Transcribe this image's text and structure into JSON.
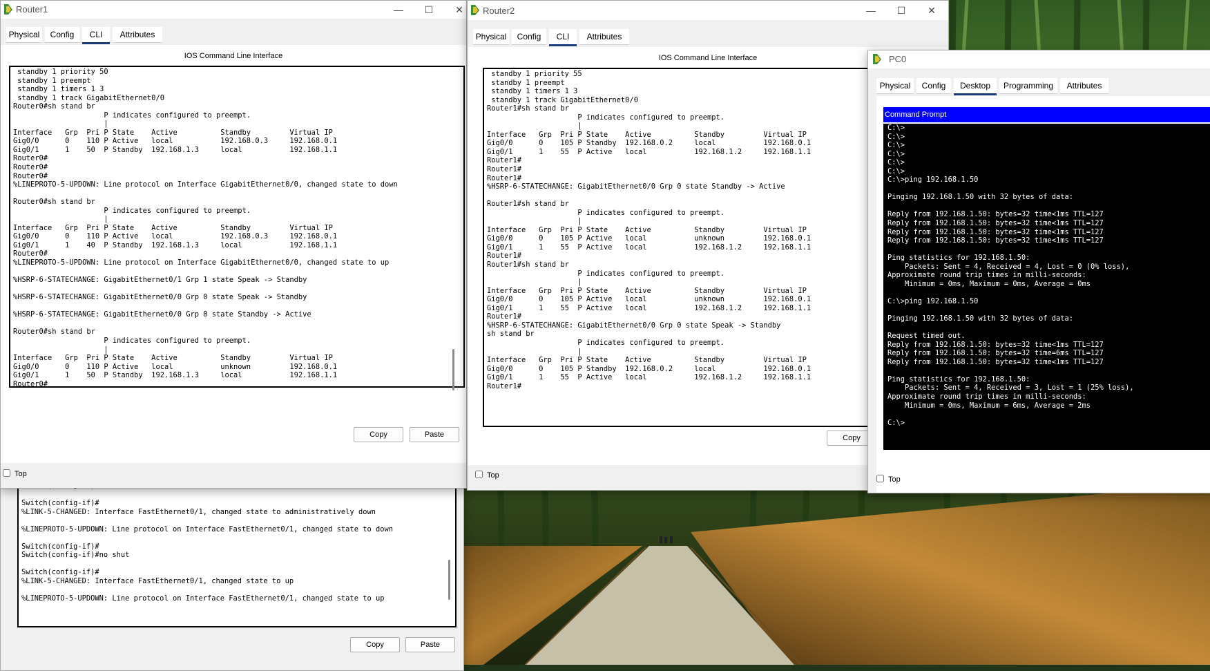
{
  "colors": {
    "accent_tab": "#1a3c78",
    "cmd_header": "#0000ff",
    "cli_bg": "#ffffff",
    "cmd_bg": "#000000"
  },
  "router1": {
    "title": "Router1",
    "tabs": [
      "Physical",
      "Config",
      "CLI",
      "Attributes"
    ],
    "active_tab": "CLI",
    "ios_label": "IOS Command Line Interface",
    "cli_lines": [
      " standby 1 priority 50",
      " standby 1 preempt",
      " standby 1 timers 1 3",
      " standby 1 track GigabitEthernet0/0",
      "Router0#sh stand br",
      "                     P indicates configured to preempt.",
      "                     |",
      "Interface   Grp  Pri P State    Active          Standby         Virtual IP",
      "Gig0/0      0    110 P Active   local           192.168.0.3     192.168.0.1",
      "Gig0/1      1    50  P Standby  192.168.1.3     local           192.168.1.1",
      "Router0#",
      "Router0#",
      "Router0#",
      "%LINEPROTO-5-UPDOWN: Line protocol on Interface GigabitEthernet0/0, changed state to down",
      "",
      "Router0#sh stand br",
      "                     P indicates configured to preempt.",
      "                     |",
      "Interface   Grp  Pri P State    Active          Standby         Virtual IP",
      "Gig0/0      0    110 P Active   local           192.168.0.3     192.168.0.1",
      "Gig0/1      1    40  P Standby  192.168.1.3     local           192.168.1.1",
      "Router0#",
      "%LINEPROTO-5-UPDOWN: Line protocol on Interface GigabitEthernet0/0, changed state to up",
      "",
      "%HSRP-6-STATECHANGE: GigabitEthernet0/1 Grp 1 state Speak -> Standby",
      "",
      "%HSRP-6-STATECHANGE: GigabitEthernet0/0 Grp 0 state Speak -> Standby",
      "",
      "%HSRP-6-STATECHANGE: GigabitEthernet0/0 Grp 0 state Standby -> Active",
      "",
      "Router0#sh stand br",
      "                     P indicates configured to preempt.",
      "                     |",
      "Interface   Grp  Pri P State    Active          Standby         Virtual IP",
      "Gig0/0      0    110 P Active   local           unknown         192.168.0.1",
      "Gig0/1      1    50  P Standby  192.168.1.3     local           192.168.1.1",
      "Router0#"
    ],
    "copy_label": "Copy",
    "paste_label": "Paste",
    "top_label": "Top"
  },
  "router2": {
    "title": "Router2",
    "tabs": [
      "Physical",
      "Config",
      "CLI",
      "Attributes"
    ],
    "active_tab": "CLI",
    "ios_label": "IOS Command Line Interface",
    "cli_lines": [
      " standby 1 priority 55",
      " standby 1 preempt",
      " standby 1 timers 1 3",
      " standby 1 track GigabitEthernet0/0",
      "Router1#sh stand br",
      "                     P indicates configured to preempt.",
      "                     |",
      "Interface   Grp  Pri P State    Active          Standby         Virtual IP",
      "Gig0/0      0    105 P Standby  192.168.0.2     local           192.168.0.1",
      "Gig0/1      1    55  P Active   local           192.168.1.2     192.168.1.1",
      "Router1#",
      "Router1#",
      "Router1#",
      "%HSRP-6-STATECHANGE: GigabitEthernet0/0 Grp 0 state Standby -> Active",
      "",
      "Router1#sh stand br",
      "                     P indicates configured to preempt.",
      "                     |",
      "Interface   Grp  Pri P State    Active          Standby         Virtual IP",
      "Gig0/0      0    105 P Active   local           unknown         192.168.0.1",
      "Gig0/1      1    55  P Active   local           192.168.1.2     192.168.1.1",
      "Router1#",
      "Router1#sh stand br",
      "                     P indicates configured to preempt.",
      "                     |",
      "Interface   Grp  Pri P State    Active          Standby         Virtual IP",
      "Gig0/0      0    105 P Active   local           unknown         192.168.0.1",
      "Gig0/1      1    55  P Active   local           192.168.1.2     192.168.1.1",
      "Router1#",
      "%HSRP-6-STATECHANGE: GigabitEthernet0/0 Grp 0 state Speak -> Standby",
      "sh stand br",
      "                     P indicates configured to preempt.",
      "                     |",
      "Interface   Grp  Pri P State    Active          Standby         Virtual IP",
      "Gig0/0      0    105 P Standby  192.168.0.2     local           192.168.0.1",
      "Gig0/1      1    55  P Active   local           192.168.1.2     192.168.1.1",
      "Router1#"
    ],
    "copy_label": "Copy",
    "top_label": "Top"
  },
  "pc0": {
    "title": "PC0",
    "tabs": [
      "Physical",
      "Config",
      "Desktop",
      "Programming",
      "Attributes"
    ],
    "active_tab": "Desktop",
    "cmd_header": "Command Prompt",
    "cmd_lines": [
      "C:\\>",
      "C:\\>",
      "C:\\>",
      "C:\\>",
      "C:\\>",
      "C:\\>",
      "C:\\>ping 192.168.1.50",
      "",
      "Pinging 192.168.1.50 with 32 bytes of data:",
      "",
      "Reply from 192.168.1.50: bytes=32 time<1ms TTL=127",
      "Reply from 192.168.1.50: bytes=32 time<1ms TTL=127",
      "Reply from 192.168.1.50: bytes=32 time<1ms TTL=127",
      "Reply from 192.168.1.50: bytes=32 time<1ms TTL=127",
      "",
      "Ping statistics for 192.168.1.50:",
      "    Packets: Sent = 4, Received = 4, Lost = 0 (0% loss),",
      "Approximate round trip times in milli-seconds:",
      "    Minimum = 0ms, Maximum = 0ms, Average = 0ms",
      "",
      "C:\\>ping 192.168.1.50",
      "",
      "Pinging 192.168.1.50 with 32 bytes of data:",
      "",
      "Request timed out.",
      "Reply from 192.168.1.50: bytes=32 time<1ms TTL=127",
      "Reply from 192.168.1.50: bytes=32 time=6ms TTL=127",
      "Reply from 192.168.1.50: bytes=32 time<1ms TTL=127",
      "",
      "Ping statistics for 192.168.1.50:",
      "    Packets: Sent = 4, Received = 3, Lost = 1 (25% loss),",
      "Approximate round trip times in milli-seconds:",
      "    Minimum = 0ms, Maximum = 6ms, Average = 2ms",
      "",
      "C:\\>"
    ],
    "top_label": "Top"
  },
  "switch": {
    "cli_lines": [
      "Switch(config-if)#shut",
      "",
      "Switch(config-if)#",
      "%LINK-5-CHANGED: Interface FastEthernet0/1, changed state to administratively down",
      "",
      "%LINEPROTO-5-UPDOWN: Line protocol on Interface FastEthernet0/1, changed state to down",
      "",
      "Switch(config-if)#",
      "Switch(config-if)#no shut",
      "",
      "Switch(config-if)#",
      "%LINK-5-CHANGED: Interface FastEthernet0/1, changed state to up",
      "",
      "%LINEPROTO-5-UPDOWN: Line protocol on Interface FastEthernet0/1, changed state to up"
    ],
    "copy_label": "Copy",
    "paste_label": "Paste"
  }
}
